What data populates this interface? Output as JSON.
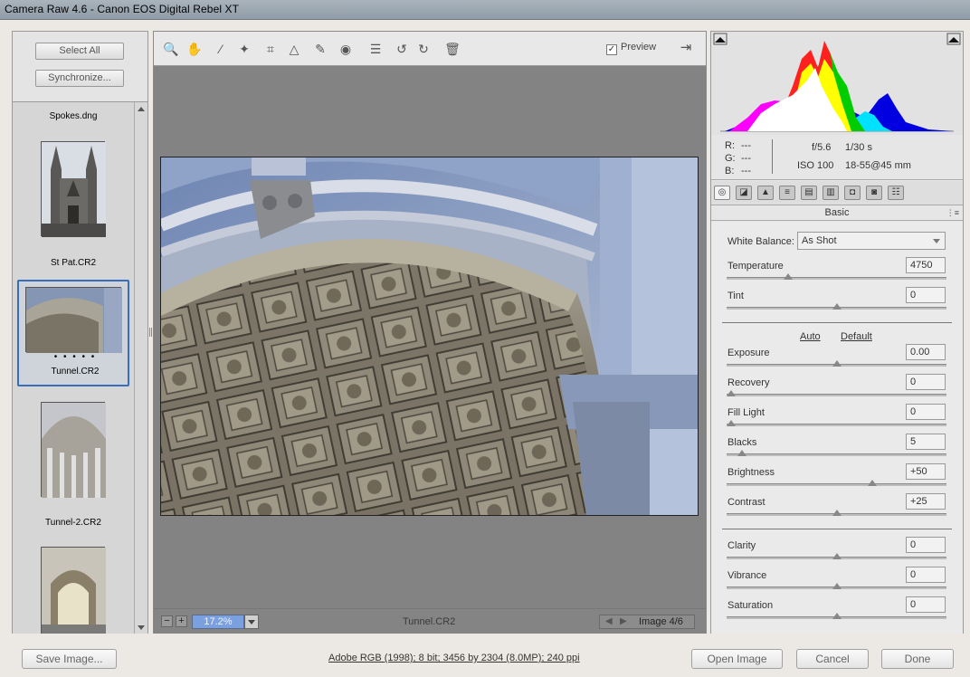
{
  "window": {
    "title": "Camera Raw 4.6  -  Canon EOS Digital Rebel XT"
  },
  "left_panel": {
    "select_all_label": "Select All",
    "synchronize_label": "Synchronize...",
    "filmstrip": [
      {
        "name": "Spokes.dng"
      },
      {
        "name": "St Pat.CR2"
      },
      {
        "name": "Tunnel.CR2",
        "rating_dots": "• • • • •",
        "selected": true
      },
      {
        "name": "Tunnel-2.CR2"
      }
    ]
  },
  "toolbar": {
    "tools": [
      {
        "name": "zoom-tool-icon",
        "glyph": "🔍"
      },
      {
        "name": "hand-tool-icon",
        "glyph": "✋"
      },
      {
        "name": "white-balance-tool-icon",
        "glyph": "⁄"
      },
      {
        "name": "color-sampler-tool-icon",
        "glyph": "✦"
      },
      {
        "name": "crop-tool-icon",
        "glyph": "⌗"
      },
      {
        "name": "straighten-tool-icon",
        "glyph": "△"
      },
      {
        "name": "retouch-tool-icon",
        "glyph": "✎"
      },
      {
        "name": "red-eye-tool-icon",
        "glyph": "◉"
      },
      {
        "name": "preferences-icon",
        "glyph": "☰"
      },
      {
        "name": "rotate-left-icon",
        "glyph": "↺"
      },
      {
        "name": "rotate-right-icon",
        "glyph": "↻"
      },
      {
        "name": "trash-icon",
        "glyph": "🗑"
      }
    ],
    "preview_label": "Preview",
    "preview_checked": "✓",
    "fullscreen_glyph": "⇥"
  },
  "statusbar": {
    "zoom_minus": "−",
    "zoom_plus": "+",
    "zoom_value": "17.2%",
    "filename": "Tunnel.CR2",
    "prev_glyph": "◀",
    "next_glyph": "▶",
    "image_counter": "Image 4/6"
  },
  "readout": {
    "r_label": "R:",
    "r_value": "---",
    "g_label": "G:",
    "g_value": "---",
    "b_label": "B:",
    "b_value": "---",
    "aperture": "f/5.6",
    "shutter": "1/30 s",
    "iso": "ISO 100",
    "lens": "18-55@45 mm"
  },
  "panel_tabs": [
    "◎",
    "◪",
    "▲",
    "≡",
    "▤",
    "▥",
    "◘",
    "◙",
    "☷"
  ],
  "basic": {
    "header": "Basic",
    "white_balance_label": "White Balance:",
    "white_balance_value": "As Shot",
    "auto_label": "Auto",
    "default_label": "Default",
    "sliders": [
      {
        "label": "Temperature",
        "value": "4750",
        "position": 0.27
      },
      {
        "label": "Tint",
        "value": "0",
        "position": 0.5
      },
      {
        "label": "Exposure",
        "value": "0.00",
        "position": 0.5
      },
      {
        "label": "Recovery",
        "value": "0",
        "position": 0.0
      },
      {
        "label": "Fill Light",
        "value": "0",
        "position": 0.0
      },
      {
        "label": "Blacks",
        "value": "5",
        "position": 0.05
      },
      {
        "label": "Brightness",
        "value": "+50",
        "position": 0.67
      },
      {
        "label": "Contrast",
        "value": "+25",
        "position": 0.5
      },
      {
        "label": "Clarity",
        "value": "0",
        "position": 0.5
      },
      {
        "label": "Vibrance",
        "value": "0",
        "position": 0.5
      },
      {
        "label": "Saturation",
        "value": "0",
        "position": 0.5
      }
    ]
  },
  "bottom": {
    "save_label": "Save Image...",
    "workflow_info": "Adobe RGB (1998); 8 bit; 3456 by 2304 (8.0MP); 240 ppi",
    "open_label": "Open Image",
    "cancel_label": "Cancel",
    "done_label": "Done"
  },
  "colors": {
    "selection_border": "#3a6cbc",
    "histogram_blue": "#0000e0",
    "histogram_red": "#ff2020",
    "histogram_yellow": "#ffff00",
    "histogram_green": "#00cc00",
    "histogram_magenta": "#ff00ff",
    "histogram_cyan": "#00e0ff"
  }
}
